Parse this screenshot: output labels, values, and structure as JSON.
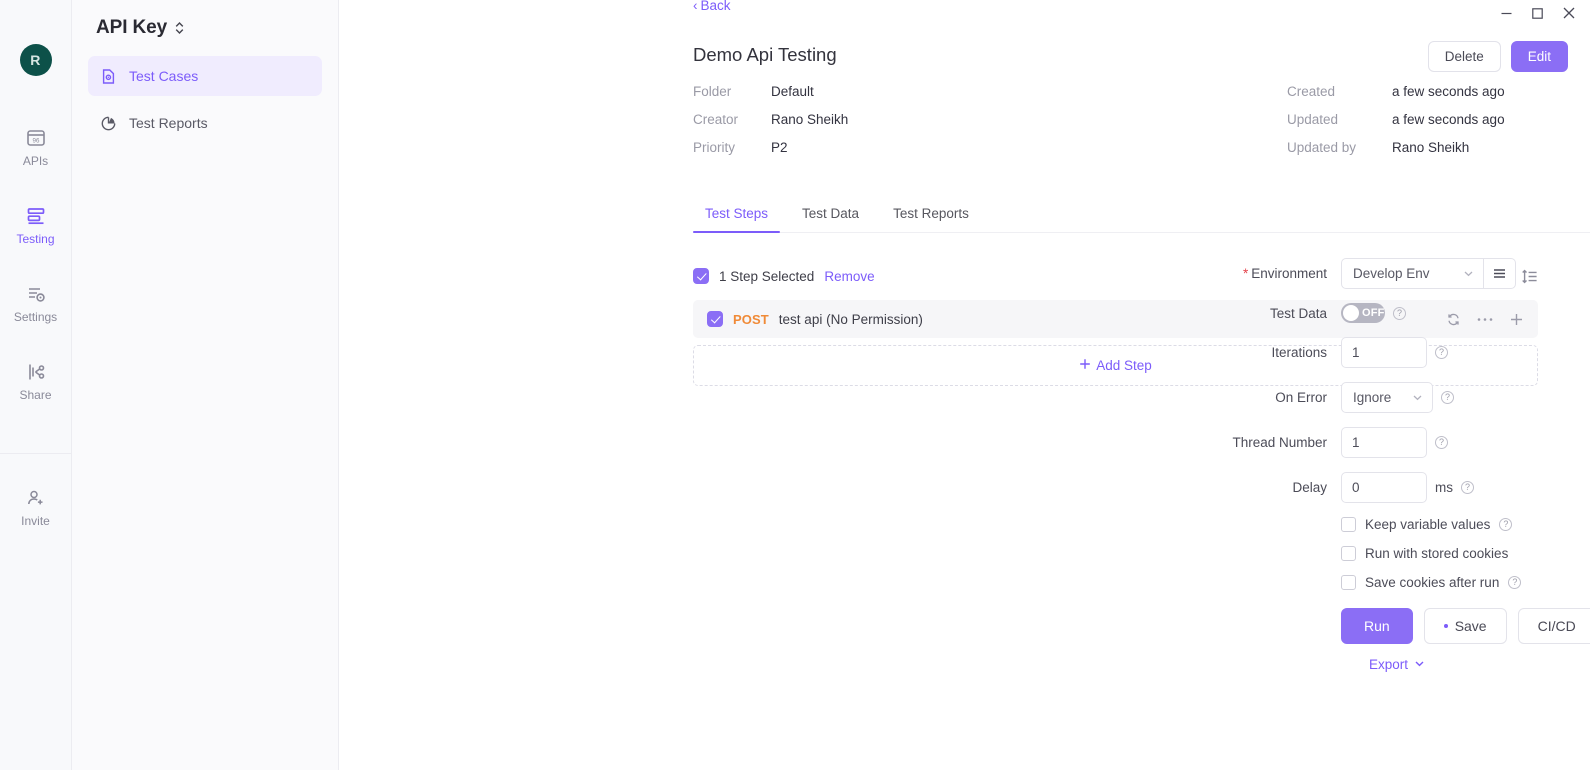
{
  "rail": {
    "avatar_initial": "R",
    "items": [
      {
        "label": "APIs",
        "icon": "apis-icon",
        "active": false
      },
      {
        "label": "Testing",
        "icon": "testing-icon",
        "active": true
      },
      {
        "label": "Settings",
        "icon": "settings-icon",
        "active": false
      },
      {
        "label": "Share",
        "icon": "share-icon",
        "active": false
      }
    ],
    "bottom": {
      "label": "Invite",
      "icon": "invite-user-icon"
    }
  },
  "sidebar": {
    "title": "API Key",
    "items": [
      {
        "label": "Test Cases",
        "icon": "test-cases-icon",
        "active": true
      },
      {
        "label": "Test Reports",
        "icon": "pie-chart-icon",
        "active": false
      }
    ]
  },
  "header": {
    "back_label": "Back",
    "title": "Demo Api Testing",
    "delete_label": "Delete",
    "edit_label": "Edit",
    "meta_left": [
      {
        "key": "Folder",
        "value": "Default"
      },
      {
        "key": "Creator",
        "value": "Rano Sheikh"
      },
      {
        "key": "Priority",
        "value": "P2"
      }
    ],
    "meta_right": [
      {
        "key": "Created",
        "value": "a few seconds ago"
      },
      {
        "key": "Updated",
        "value": "a few seconds ago"
      },
      {
        "key": "Updated by",
        "value": "Rano Sheikh"
      }
    ]
  },
  "tabs": [
    {
      "label": "Test Steps",
      "active": true
    },
    {
      "label": "Test Data",
      "active": false
    },
    {
      "label": "Test Reports",
      "active": false
    }
  ],
  "steps": {
    "selected_label": "1 Step Selected",
    "remove_label": "Remove",
    "rows": [
      {
        "method": "POST",
        "name": "test api (No Permission)",
        "checked": true
      }
    ],
    "add_step_label": "Add Step"
  },
  "config": {
    "environment": {
      "label": "Environment",
      "required": true,
      "value": "Develop Env"
    },
    "test_data": {
      "label": "Test Data",
      "state": "OFF"
    },
    "iterations": {
      "label": "Iterations",
      "value": "1"
    },
    "on_error": {
      "label": "On Error",
      "value": "Ignore"
    },
    "thread_number": {
      "label": "Thread Number",
      "value": "1"
    },
    "delay": {
      "label": "Delay",
      "value": "0",
      "unit": "ms"
    },
    "checkboxes": [
      {
        "label": "Keep variable values",
        "checked": false,
        "help": true
      },
      {
        "label": "Run with stored cookies",
        "checked": false,
        "help": false
      },
      {
        "label": "Save cookies after run",
        "checked": false,
        "help": true
      }
    ],
    "run_label": "Run",
    "save_label": "Save",
    "cicd_label": "CI/CD",
    "export_label": "Export"
  },
  "colors": {
    "accent": "#7c5cfa",
    "accent_button": "#8b6ef5",
    "method_post": "#f08a37",
    "avatar_bg": "#0d5149",
    "required": "#e4434b"
  }
}
